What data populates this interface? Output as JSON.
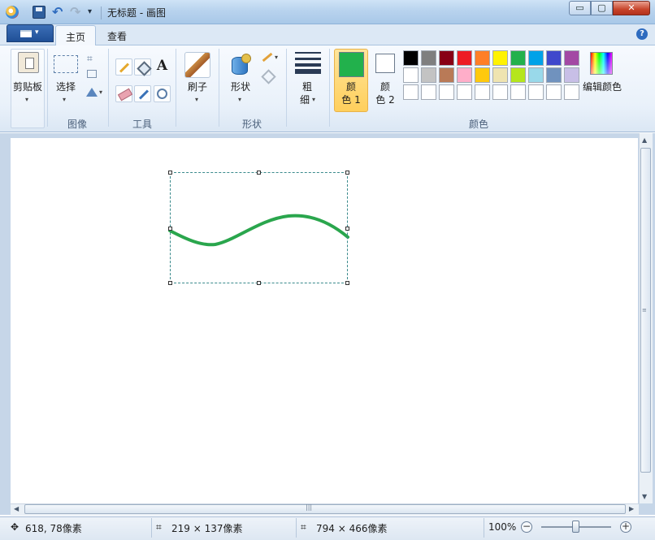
{
  "window": {
    "title": "无标题 - 画图",
    "min_glyph": "▭",
    "max_glyph": "▢",
    "close_glyph": "✕"
  },
  "quick_access": {
    "undo_glyph": "↶",
    "redo_glyph": "↷",
    "dropdown_glyph": "▾"
  },
  "tabs": {
    "home": "主页",
    "view": "查看",
    "help_glyph": "?"
  },
  "ribbon": {
    "clipboard": {
      "label": "剪贴板"
    },
    "image": {
      "group": "图像",
      "select": "选择"
    },
    "tools": {
      "group": "工具",
      "text_glyph": "A"
    },
    "brushes": {
      "label": "刷子"
    },
    "shapes": {
      "group": "形状",
      "label": "形状"
    },
    "size": {
      "line1": "粗",
      "line2": "细"
    },
    "color1": {
      "line1": "颜",
      "line2": "色 1",
      "value": "#22b14c"
    },
    "color2": {
      "line1": "颜",
      "line2": "色 2",
      "value": "#ffffff"
    },
    "colors": {
      "group": "颜色",
      "edit": "编辑颜色"
    },
    "dropdown_glyph": "▾"
  },
  "palette": [
    [
      "#000000",
      "#7f7f7f",
      "#880015",
      "#ed1c24",
      "#ff7f27",
      "#fff200",
      "#22b14c",
      "#00a2e8",
      "#3f48cc",
      "#a349a4"
    ],
    [
      "#ffffff",
      "#c3c3c3",
      "#b97a57",
      "#ffaec9",
      "#ffc90e",
      "#efe4b0",
      "#b5e61d",
      "#99d9ea",
      "#7092be",
      "#c8bfe7"
    ],
    [
      "#ffffff",
      "#ffffff",
      "#ffffff",
      "#ffffff",
      "#ffffff",
      "#ffffff",
      "#ffffff",
      "#ffffff",
      "#ffffff",
      "#ffffff"
    ]
  ],
  "canvas": {
    "stroke_color": "#2aa64d"
  },
  "status": {
    "cursor": "618, 78像素",
    "selection": "219 × 137像素",
    "image_size": "794 × 466像素",
    "zoom": "100%",
    "zoom_out_glyph": "−",
    "zoom_in_glyph": "+"
  },
  "scrollbar": {
    "up": "▲",
    "down": "▼",
    "left": "◀",
    "right": "▶",
    "grip_v": "≡",
    "grip_h": "|||"
  }
}
